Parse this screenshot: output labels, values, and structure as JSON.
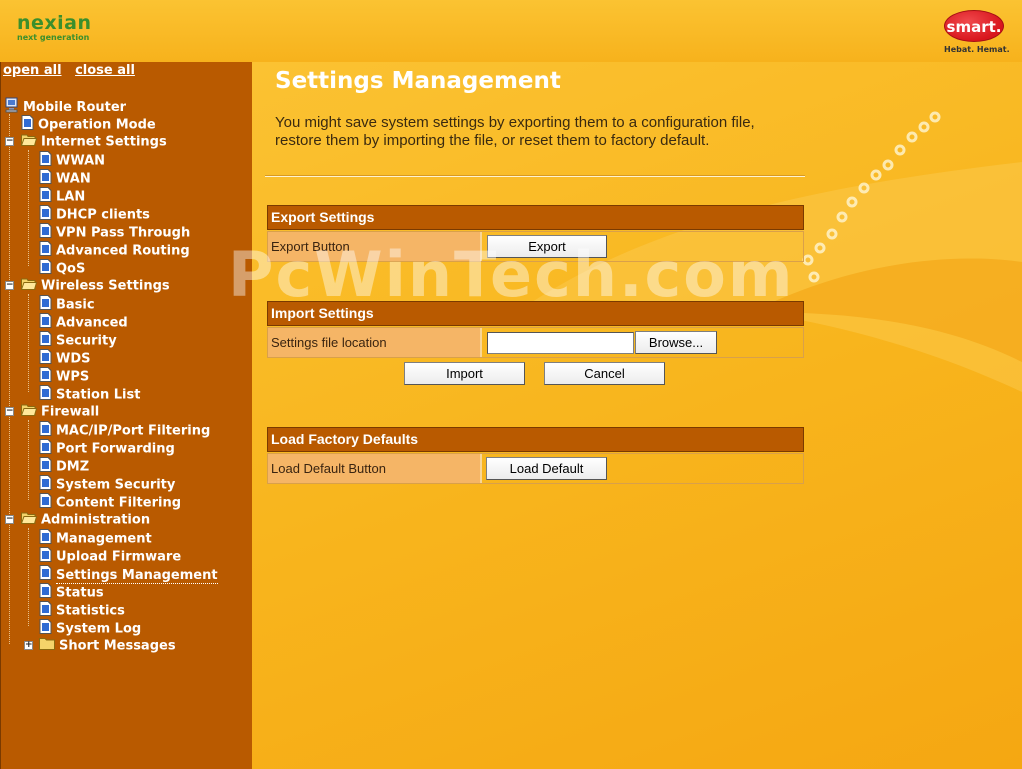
{
  "header": {
    "left_brand": "nexian",
    "left_tagline": "next generation",
    "right_brand": "smart.",
    "right_slogan": "Hebat. Hemat."
  },
  "tree_controls": {
    "open_all": "open all",
    "close_all": "close all"
  },
  "tree": {
    "root": "Mobile Router",
    "operation_mode": "Operation Mode",
    "internet_settings": {
      "label": "Internet Settings",
      "items": [
        "WWAN",
        "WAN",
        "LAN",
        "DHCP clients",
        "VPN Pass Through",
        "Advanced Routing",
        "QoS"
      ]
    },
    "wireless_settings": {
      "label": "Wireless Settings",
      "items": [
        "Basic",
        "Advanced",
        "Security",
        "WDS",
        "WPS",
        "Station List"
      ]
    },
    "firewall": {
      "label": "Firewall",
      "items": [
        "MAC/IP/Port Filtering",
        "Port Forwarding",
        "DMZ",
        "System Security",
        "Content Filtering"
      ]
    },
    "administration": {
      "label": "Administration",
      "items": [
        "Management",
        "Upload Firmware",
        "Settings Management",
        "Status",
        "Statistics",
        "System Log"
      ]
    },
    "short_messages": "Short Messages",
    "selected": "Settings Management"
  },
  "main": {
    "title": "Settings Management",
    "description": "You might save system settings by exporting them to a configuration file, restore them by importing the file, or reset them to factory default.",
    "export": {
      "heading": "Export Settings",
      "row_label": "Export Button",
      "button": "Export"
    },
    "import": {
      "heading": "Import Settings",
      "row_label": "Settings file location",
      "file_value": "",
      "browse_button": "Browse...",
      "import_button": "Import",
      "cancel_button": "Cancel"
    },
    "factory": {
      "heading": "Load Factory Defaults",
      "row_label": "Load Default Button",
      "button": "Load Default"
    }
  },
  "watermark": "PcWinTech.com",
  "colors": {
    "sidebar_bg": "#b95a00",
    "section_header_bg": "#b95a00",
    "label_cell_bg": "#f5b566",
    "page_bg": "#f8b51d"
  }
}
